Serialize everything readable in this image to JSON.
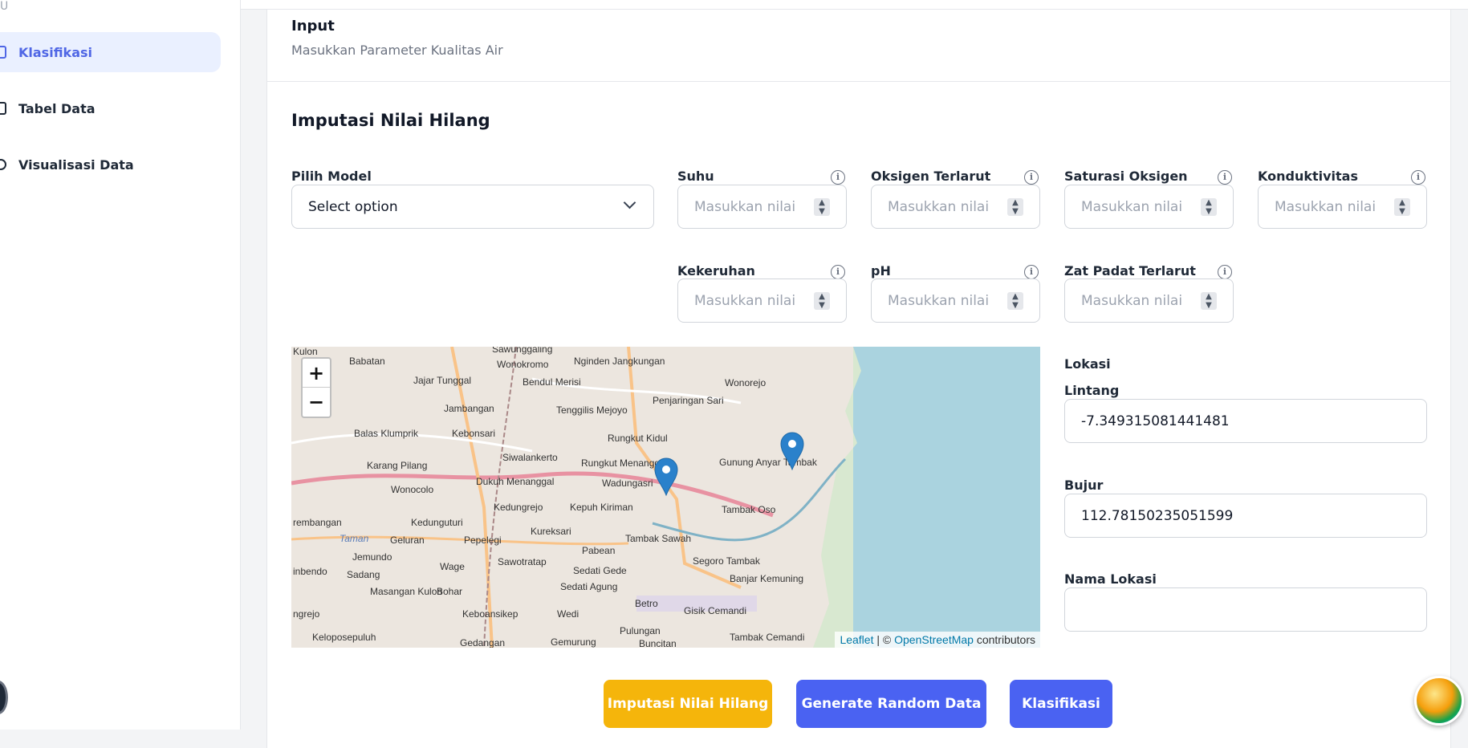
{
  "sidebar": {
    "top_stub": "U",
    "items": [
      {
        "label": "Klasifikasi",
        "active": true
      },
      {
        "label": "Tabel Data",
        "active": false
      },
      {
        "label": "Visualisasi Data",
        "active": false
      }
    ]
  },
  "card": {
    "title": "Input",
    "subtitle": "Masukkan Parameter Kualitas Air"
  },
  "form": {
    "section_title": "Imputasi Nilai Hilang",
    "model_label": "Pilih Model",
    "model_value": "Select option",
    "fields": [
      {
        "label": "Suhu",
        "placeholder": "Masukkan nilai"
      },
      {
        "label": "Oksigen Terlarut",
        "placeholder": "Masukkan nilai"
      },
      {
        "label": "Saturasi Oksigen",
        "placeholder": "Masukkan nilai"
      },
      {
        "label": "Konduktivitas",
        "placeholder": "Masukkan nilai"
      },
      {
        "label": "Kekeruhan",
        "placeholder": "Masukkan nilai"
      },
      {
        "label": "pH",
        "placeholder": "Masukkan nilai"
      },
      {
        "label": "Zat Padat Terlarut",
        "placeholder": "Masukkan nilai"
      }
    ],
    "location": {
      "heading": "Lokasi",
      "lat_label": "Lintang",
      "lat_value": "-7.349315081441481",
      "lon_label": "Bujur",
      "lon_value": "112.78150235051599",
      "name_label": "Nama Lokasi",
      "name_value": ""
    }
  },
  "map": {
    "zoom_in": "+",
    "zoom_out": "−",
    "labels": [
      "Kulon",
      "Sawunggaling",
      "Babatan",
      "Wonokromo",
      "Nginden Jangkungan",
      "Jajar Tunggal",
      "Bendul Merisi",
      "Wonorejo",
      "Jambangan",
      "Tenggilis Mejoyo",
      "Penjaringan Sari",
      "Balas Klumprik",
      "Kebonsari",
      "Rungkut Kidul",
      "Karang Pilang",
      "Siwalankerto",
      "Rungkut Menanggal",
      "Gunung Anyar Tambak",
      "Wonocolo",
      "Dukuh Menanggal",
      "Wadungasri",
      "Kedungrejo",
      "Kepuh Kiriman",
      "Tambak Oso",
      "Kedunguturi",
      "Geluran",
      "Pepelegi",
      "Kureksari",
      "Tambak Sawah",
      "Taman",
      "Jemundo",
      "Wage",
      "Sawotratap",
      "Pabean",
      "Segoro Tambak",
      "Sadang",
      "Sedati Gede",
      "Banjar Kemuning",
      "Masangan Kulon",
      "Bohar",
      "Sedati Agung",
      "Betro",
      "Gisik Cemandi",
      "Keboansikep",
      "Wedi",
      "Pulungan",
      "Keloposepuluh",
      "Gedangan",
      "Gemurung",
      "Buncitan",
      "Tambak Cemandi",
      "ngrejo",
      "inbendo",
      "rembangan"
    ],
    "attribution_leaflet": "Leaflet",
    "attribution_sep": " | © ",
    "attribution_osm": "OpenStreetMap",
    "attribution_tail": " contributors"
  },
  "buttons": {
    "impute": "Imputasi Nilai Hilang",
    "random": "Generate Random Data",
    "classify": "Klasifikasi"
  },
  "colors": {
    "accent": "#4a62f2",
    "warning": "#f5b50b",
    "active_bg": "#eaf0ff"
  }
}
